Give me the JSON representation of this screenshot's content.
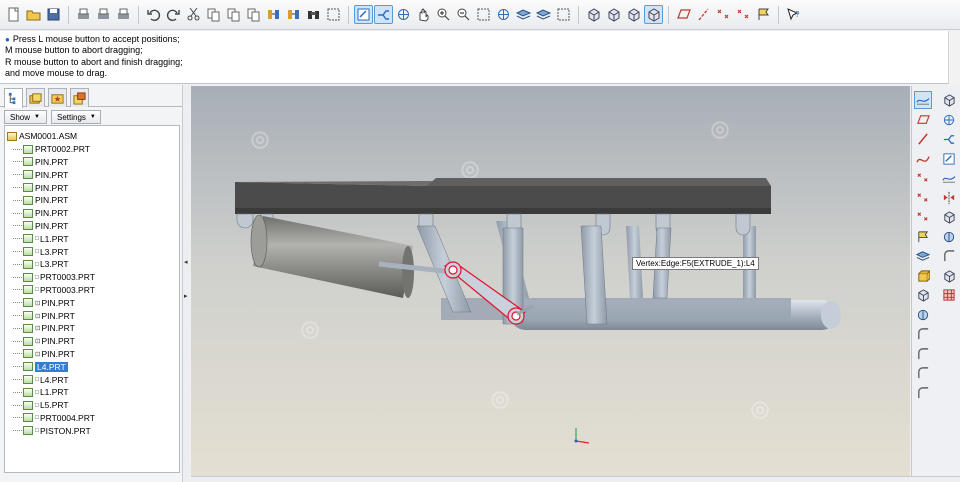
{
  "toolbar": {
    "items": [
      {
        "icon": "new-file-icon",
        "kind": "doc"
      },
      {
        "icon": "open-folder-icon",
        "kind": "folder"
      },
      {
        "icon": "save-icon",
        "kind": "save"
      },
      {
        "sep": true
      },
      {
        "icon": "print-icon",
        "kind": "print"
      },
      {
        "icon": "send-mail-icon",
        "kind": "print"
      },
      {
        "icon": "close-window-icon",
        "kind": "print"
      },
      {
        "sep": true
      },
      {
        "icon": "undo-icon",
        "kind": "undo"
      },
      {
        "icon": "redo-icon",
        "kind": "redo"
      },
      {
        "icon": "cut-icon",
        "kind": "cut"
      },
      {
        "icon": "copy-icon",
        "kind": "copy"
      },
      {
        "icon": "paste-icon",
        "kind": "copy"
      },
      {
        "icon": "paste-special-icon",
        "kind": "copy"
      },
      {
        "icon": "regenerate-icon",
        "kind": "regen"
      },
      {
        "icon": "regenerate-manager-icon",
        "kind": "regen"
      },
      {
        "icon": "find-icon",
        "kind": "find"
      },
      {
        "icon": "selection-filter-icon",
        "kind": "box"
      },
      {
        "sep": true
      },
      {
        "icon": "drag-components-icon",
        "kind": "drag",
        "active": true
      },
      {
        "icon": "select-mode-icon",
        "kind": "select",
        "active": true
      },
      {
        "icon": "orient-icon",
        "kind": "orient"
      },
      {
        "icon": "pan-hand-icon",
        "kind": "hand"
      },
      {
        "icon": "zoom-in-icon",
        "kind": "zoomin"
      },
      {
        "icon": "zoom-out-icon",
        "kind": "zoomout"
      },
      {
        "icon": "refit-icon",
        "kind": "box"
      },
      {
        "icon": "reorient-icon",
        "kind": "orient"
      },
      {
        "icon": "saved-views-icon",
        "kind": "layers"
      },
      {
        "icon": "layers-icon",
        "kind": "layers"
      },
      {
        "icon": "view-manager-icon",
        "kind": "box"
      },
      {
        "sep": true
      },
      {
        "icon": "wireframe-icon",
        "kind": "cube"
      },
      {
        "icon": "hidden-line-icon",
        "kind": "cube"
      },
      {
        "icon": "no-hidden-icon",
        "kind": "cube"
      },
      {
        "icon": "shading-icon",
        "kind": "cube",
        "active": true
      },
      {
        "sep": true
      },
      {
        "icon": "datum-planes-icon",
        "kind": "plane"
      },
      {
        "icon": "datum-axes-icon",
        "kind": "axis"
      },
      {
        "icon": "datum-points-icon",
        "kind": "points"
      },
      {
        "icon": "coordinate-systems-icon",
        "kind": "points"
      },
      {
        "icon": "annotations-icon",
        "kind": "flag"
      },
      {
        "sep": true
      },
      {
        "icon": "context-help-icon",
        "kind": "help"
      }
    ]
  },
  "message": {
    "lines": [
      "Press L mouse button to accept positions;",
      "M mouse button to abort dragging;",
      "R mouse button to abort and finish dragging;",
      "and move mouse to drag."
    ]
  },
  "panel": {
    "show_label": "Show",
    "settings_label": "Settings"
  },
  "tree": {
    "root": "ASM0001.ASM",
    "items": [
      {
        "label": "PRT0002.PRT",
        "mark": ""
      },
      {
        "label": "PIN.PRT",
        "mark": ""
      },
      {
        "label": "PIN.PRT",
        "mark": ""
      },
      {
        "label": "PIN.PRT",
        "mark": ""
      },
      {
        "label": "PIN.PRT",
        "mark": ""
      },
      {
        "label": "PIN.PRT",
        "mark": ""
      },
      {
        "label": "PIN.PRT",
        "mark": ""
      },
      {
        "label": "L1.PRT",
        "mark": "□"
      },
      {
        "label": "L3.PRT",
        "mark": "□"
      },
      {
        "label": "L3.PRT",
        "mark": "□"
      },
      {
        "label": "PRT0003.PRT",
        "mark": "□"
      },
      {
        "label": "PRT0003.PRT",
        "mark": "□"
      },
      {
        "label": "PIN.PRT",
        "mark": "⊡"
      },
      {
        "label": "PIN.PRT",
        "mark": "⊡"
      },
      {
        "label": "PIN.PRT",
        "mark": "⊡"
      },
      {
        "label": "PIN.PRT",
        "mark": "⊡"
      },
      {
        "label": "PIN.PRT",
        "mark": "⊡"
      },
      {
        "label": "L4.PRT",
        "mark": "",
        "selected": true
      },
      {
        "label": "L4.PRT",
        "mark": "□"
      },
      {
        "label": "L1.PRT",
        "mark": "□"
      },
      {
        "label": "L5.PRT",
        "mark": "□"
      },
      {
        "label": "PRT0004.PRT",
        "mark": "□"
      },
      {
        "label": "PISTON.PRT",
        "mark": "□"
      }
    ]
  },
  "viewport": {
    "tooltip": "Vertex:Edge:F5(EXTRUDE_1):L4",
    "colors": {
      "part_gray": "#a9b4c2",
      "top_plate": "#5a5a5a",
      "cylinder": "#8a8a86",
      "highlight": "#e0122e"
    }
  },
  "rightbar": {
    "col1": [
      "sketch-icon",
      "plane-icon",
      "line-icon",
      "spline-icon",
      "point-icon",
      "axis-icon",
      "csys-icon",
      "insert-feature-icon",
      "view-icon",
      "component-place-icon",
      "assemble-icon",
      "constraint-icon",
      "round-icon",
      "chamfer-icon",
      "draft-icon",
      "pattern-icon"
    ],
    "col2": [
      "datum-plane-icon",
      "datum-axis-icon",
      "datum-curve-icon",
      "datum-point-icon",
      "datum-csys-icon",
      "mirror-icon",
      "extrude-icon",
      "revolve-icon",
      "sweep-icon",
      "blend-icon",
      "appearance-icon"
    ]
  }
}
